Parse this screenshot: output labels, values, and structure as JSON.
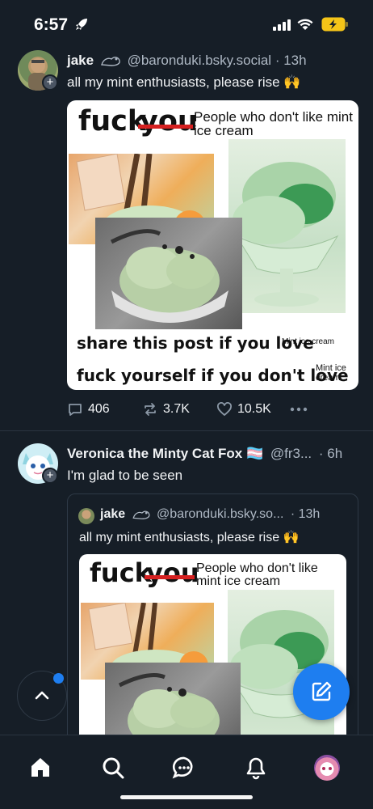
{
  "status": {
    "time": "6:57"
  },
  "post1": {
    "author_name": "jake",
    "handle": "@baronduki.bsky.social",
    "time": "· 13h",
    "text": "all my mint enthusiasts, please rise 🙌",
    "replies": "406",
    "reposts": "3.7K",
    "likes": "10.5K"
  },
  "meme": {
    "fuck": "fuck",
    "you": "you",
    "caption_top": "People who don't like mint ice cream",
    "share_line": "share this post if you love",
    "share_small": "Mint ice cream",
    "fuck_line": "fuck yourself if you don't love",
    "fuck_small": "Mint ice cream"
  },
  "post2": {
    "author_name": "Veronica the Minty Cat Fox 🏳️‍⚧️",
    "handle": "@fr3...",
    "time": "· 6h",
    "text": "I'm glad to be seen"
  },
  "quote": {
    "author_name": "jake",
    "handle": "@baronduki.bsky.so...",
    "time": "· 13h",
    "text": "all my mint enthusiasts, please rise 🙌"
  },
  "colors": {
    "background": "#161e27",
    "accent": "#1e7ef0",
    "muted": "#8b98a6"
  }
}
